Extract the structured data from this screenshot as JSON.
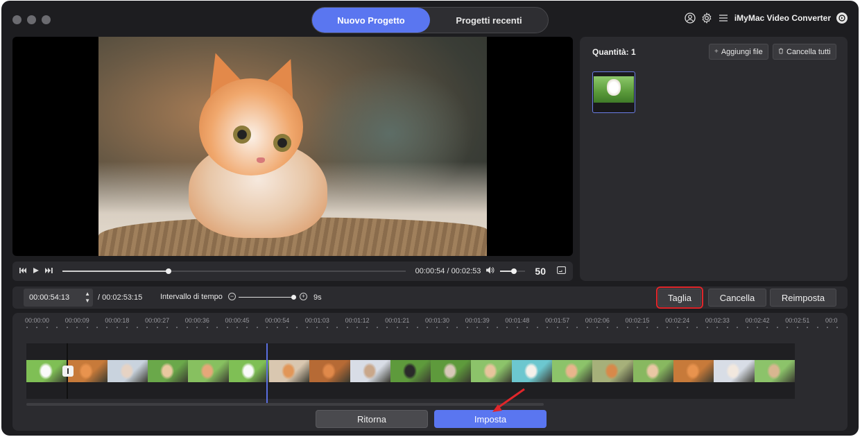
{
  "header": {
    "tabs": [
      {
        "label": "Nuovo Progetto",
        "active": true
      },
      {
        "label": "Progetti recenti",
        "active": false
      }
    ],
    "app_name": "iMyMac Video Converter",
    "icons": [
      "user-icon",
      "gear-icon",
      "menu-icon",
      "app-logo-icon"
    ]
  },
  "player": {
    "current_time": "00:00:54",
    "total_time": "00:02:53",
    "time_separator": " / ",
    "progress_fraction": 0.31,
    "volume": "50",
    "volume_fraction": 0.55
  },
  "files_panel": {
    "quantity_label": "Quantità: 1",
    "add_button": "Aggiungi file",
    "clear_button": "Cancella tutti"
  },
  "trim": {
    "timecode_value": "00:00:54:13",
    "total_label": "/ 00:02:53:15",
    "interval_label": "Intervallo di tempo",
    "interval_value": "9s",
    "cut_button": "Taglia",
    "cancel_button": "Cancella",
    "reset_button": "Reimposta"
  },
  "timeline": {
    "ticks": [
      "00:00:00",
      "00:00:09",
      "00:00:18",
      "00:00:27",
      "00:00:36",
      "00:00:45",
      "00:00:54",
      "00:01:03",
      "00:01:12",
      "00:01:21",
      "00:01:30",
      "00:01:39",
      "00:01:48",
      "00:01:57",
      "00:02:06",
      "00:02:15",
      "00:02:24",
      "00:02:33",
      "00:02:42",
      "00:02:51",
      "00:0"
    ],
    "playhead_fraction": 0.312
  },
  "footer": {
    "back_button": "Ritorna",
    "set_button": "Imposta"
  },
  "colors": {
    "accent": "#5a76f0",
    "highlight": "#e0262b",
    "panel": "#2b2b2f"
  }
}
